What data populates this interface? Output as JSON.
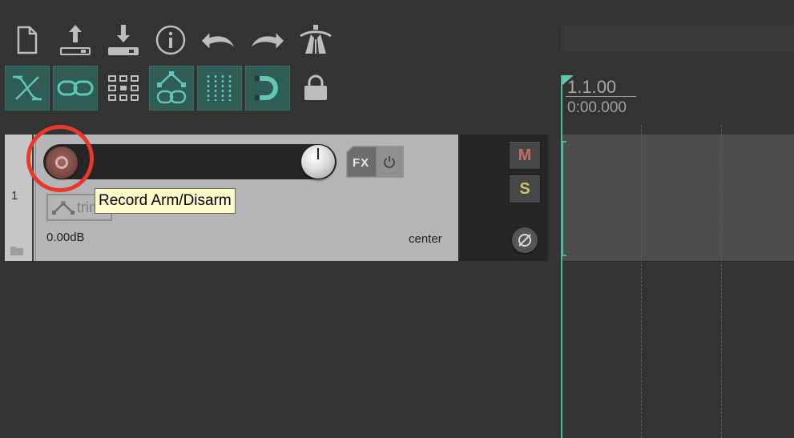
{
  "toolbar": {
    "icons": [
      "new-project-icon",
      "upload-icon",
      "download-icon",
      "info-icon",
      "undo-icon",
      "redo-icon",
      "metronome-icon"
    ]
  },
  "toggles": [
    {
      "name": "ripple-editing-toggle",
      "icon": "ripple-icon",
      "active": true
    },
    {
      "name": "item-grouping-toggle",
      "icon": "link-icon",
      "active": true
    },
    {
      "name": "snap-grid-toggle",
      "icon": "grid-icon",
      "active": false
    },
    {
      "name": "envelope-points-toggle",
      "icon": "envelope-link-icon",
      "active": true
    },
    {
      "name": "grid-lines-toggle",
      "icon": "grid-lines-icon",
      "active": true
    },
    {
      "name": "snap-toggle",
      "icon": "magnet-icon",
      "active": true
    },
    {
      "name": "lock-toggle",
      "icon": "lock-icon",
      "active": false
    }
  ],
  "track": {
    "number": "1",
    "volume": "0.00dB",
    "pan": "center",
    "automation_mode": "trim",
    "fx_label": "FX",
    "mute_label": "M",
    "solo_label": "S",
    "record_arm_tooltip": "Record Arm/Disarm"
  },
  "transport": {
    "position_bars": "1.1.00",
    "position_time": "0:00.000"
  },
  "colors": {
    "accent": "#4fb6a2",
    "highlight_ring": "#e8382a",
    "mute": "#c46d62",
    "solo": "#c9c46f"
  }
}
